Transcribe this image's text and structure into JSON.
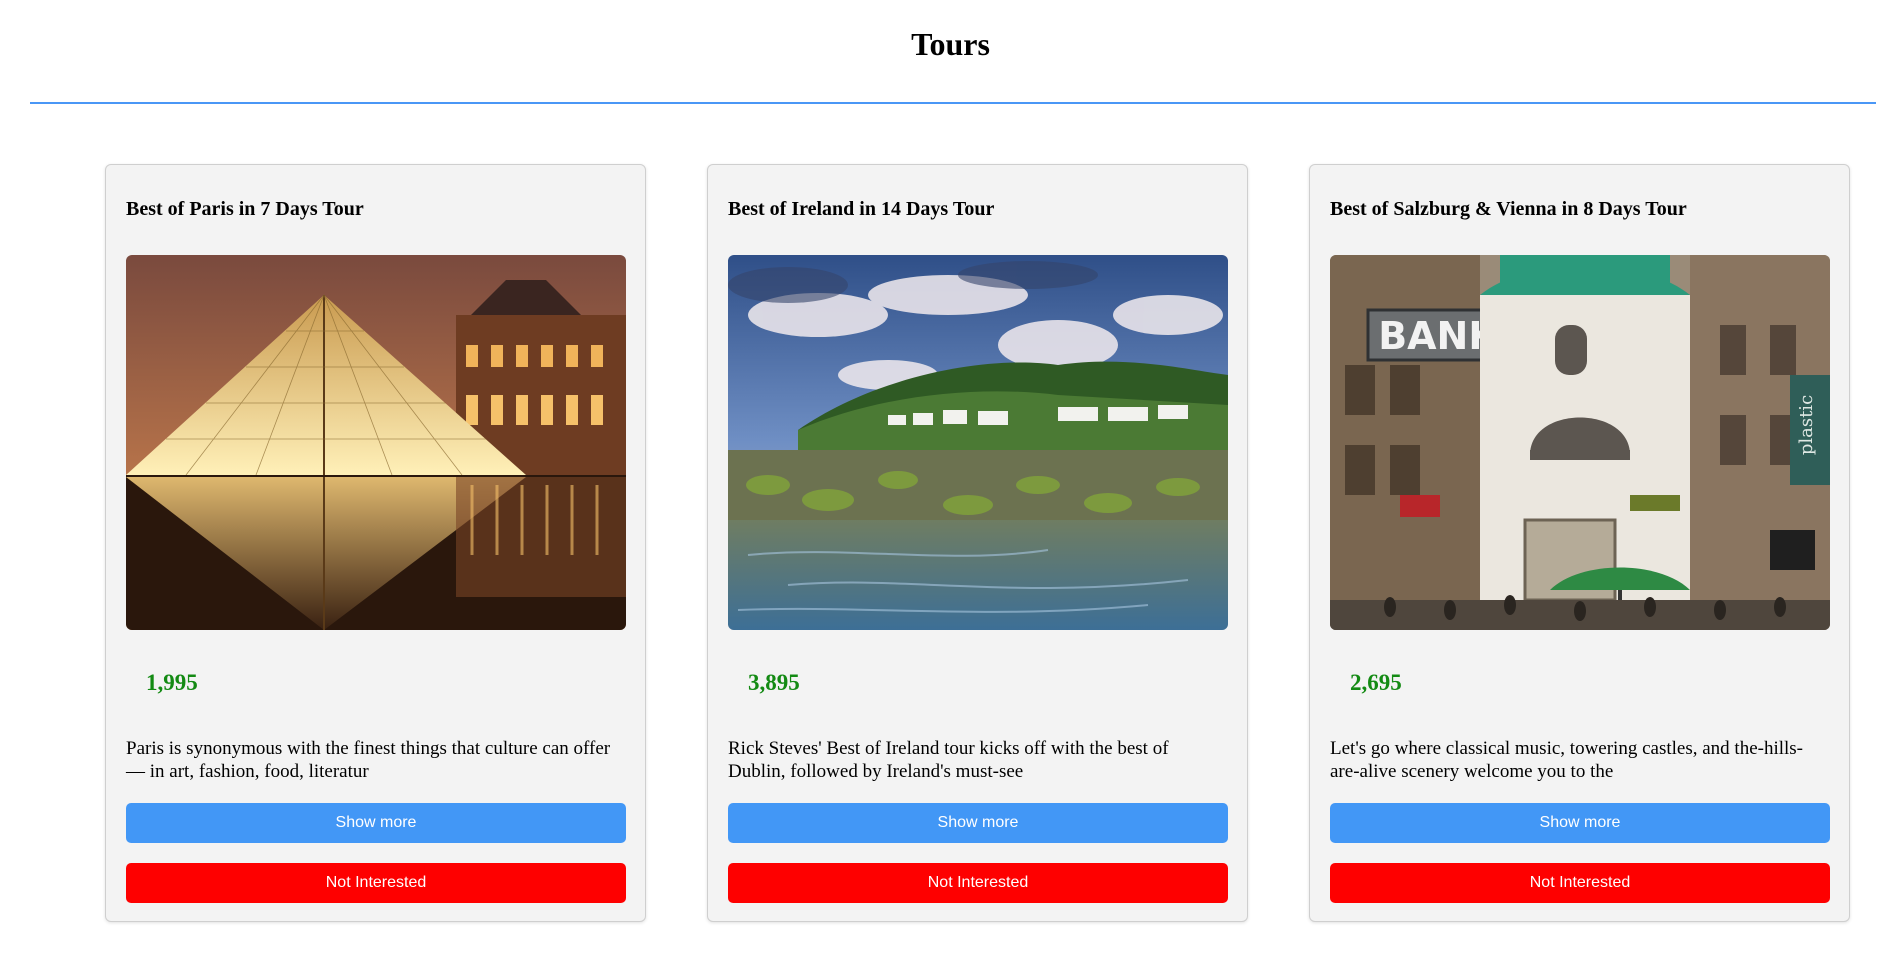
{
  "page": {
    "title": "Tours"
  },
  "colors": {
    "divider": "#4a97f6",
    "price": "#138a13",
    "show_more_button": "#4297f6",
    "not_interested_button": "#fe0000"
  },
  "tours": [
    {
      "title": "Best of Paris in 7 Days Tour",
      "image": "louvre-pyramid-night-photo",
      "price": "1,995",
      "description": "Paris is synonymous with the finest things that culture can offer — in art, fashion, food, literatur",
      "show_more_label": "Show more",
      "not_interested_label": "Not Interested"
    },
    {
      "title": "Best of Ireland in 14 Days Tour",
      "image": "ireland-coast-rocks-photo",
      "price": "3,895",
      "description": "Rick Steves' Best of Ireland tour kicks off with the best of Dublin, followed by Ireland's must-see",
      "show_more_label": "Show more",
      "not_interested_label": "Not Interested"
    },
    {
      "title": "Best of Salzburg & Vienna in 8 Days Tour",
      "image": "vienna-street-bank-photo",
      "price": "2,695",
      "description": "Let's go where classical music, towering castles, and the-hills-are-alive scenery welcome you to the",
      "show_more_label": "Show more",
      "not_interested_label": "Not Interested"
    }
  ]
}
